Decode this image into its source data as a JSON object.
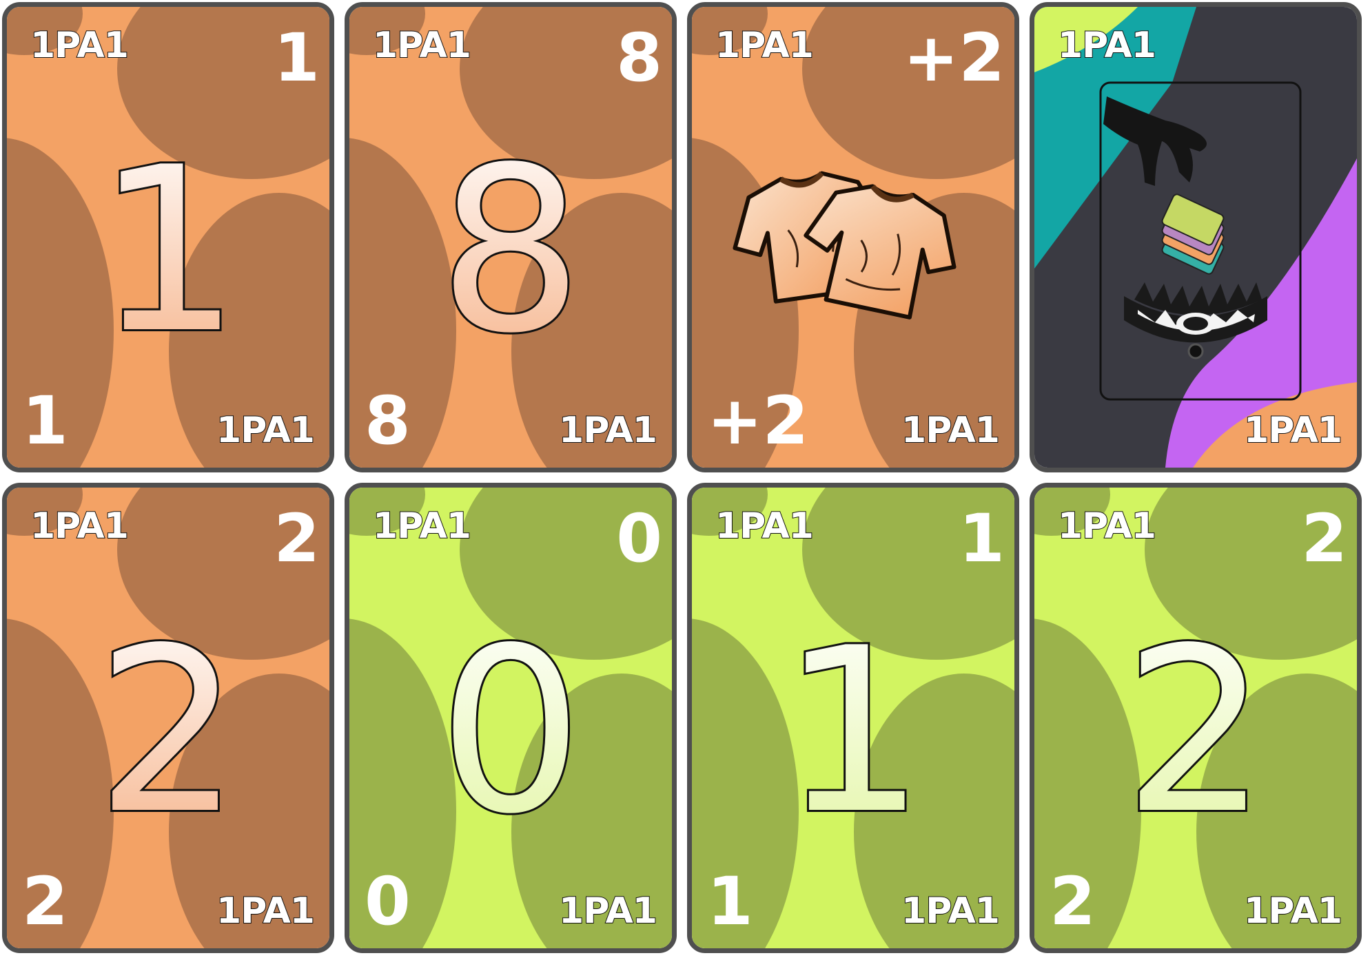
{
  "theme": {
    "orange": {
      "light": "#f3a265",
      "dark": "#b4774d",
      "grad_top": "#ffffff",
      "grad_bottom": "#f6b38a"
    },
    "green": {
      "light": "#d2f461",
      "dark": "#9bb34b",
      "grad_top": "#ffffff",
      "grad_bottom": "#e3f6a5"
    },
    "wild": {
      "dark": "#3a3a42",
      "teal": "#13a6a5",
      "lime": "#d3f461",
      "purple": "#c465f2",
      "orange": "#f3a265"
    },
    "border": "#4f4f4f"
  },
  "cards": [
    {
      "color": "orange",
      "value": "1",
      "brand": "1PA1"
    },
    {
      "color": "orange",
      "value": "8",
      "brand": "1PA1"
    },
    {
      "color": "orange",
      "value": "+2",
      "brand": "1PA1",
      "icon": "two-shirts-icon"
    },
    {
      "color": "wild",
      "value": "",
      "brand": "1PA1",
      "icon": "hand-stack-trap-icon"
    },
    {
      "color": "orange",
      "value": "2",
      "brand": "1PA1"
    },
    {
      "color": "green",
      "value": "0",
      "brand": "1PA1"
    },
    {
      "color": "green",
      "value": "1",
      "brand": "1PA1"
    },
    {
      "color": "green",
      "value": "2",
      "brand": "1PA1"
    }
  ]
}
